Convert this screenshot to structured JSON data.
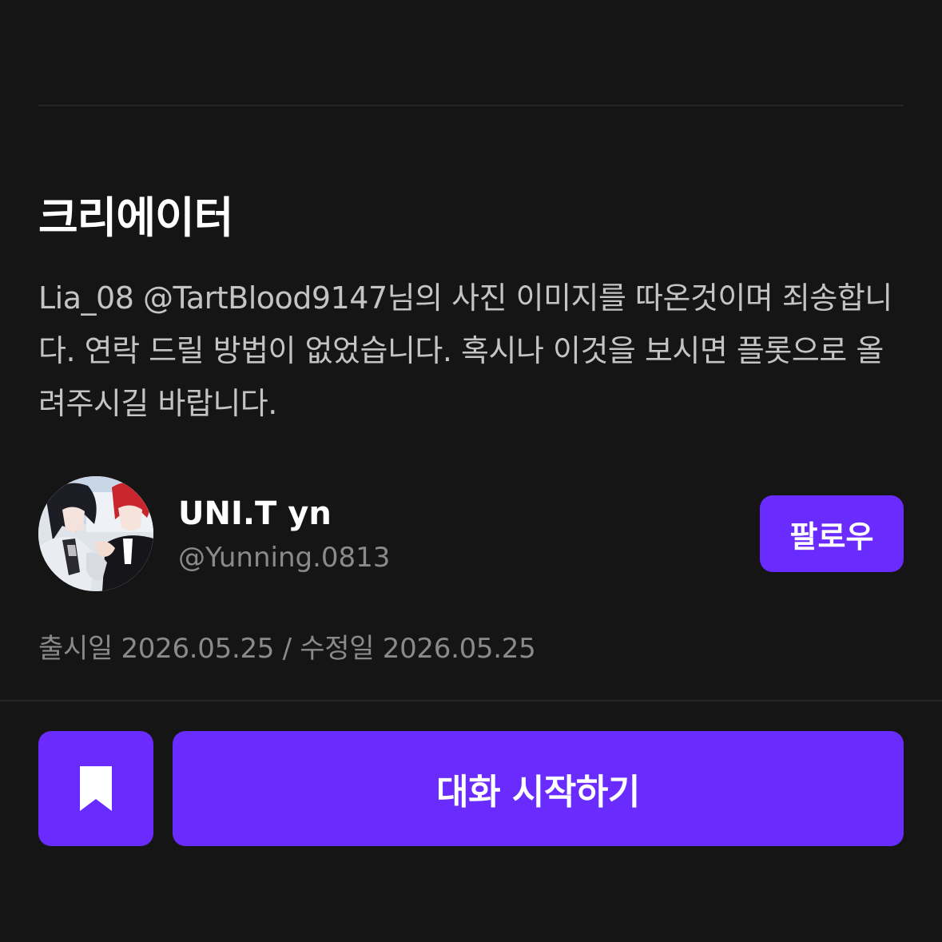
{
  "section": {
    "title": "크리에이터",
    "description": "Lia_08 @TartBlood9147님의 사진 이미지를 따온것이며 죄송합니다. 연락 드릴 방법이 없었습니다. 혹시나 이것을 보시면 플롯으로 올려주시길 바랍니다."
  },
  "creator": {
    "name": "UNI.T yn",
    "handle": "@Yunning.0813",
    "follow_label": "팔로우",
    "avatar_icon": "character-avatar-image"
  },
  "release_info": "출시일 2026.05.25 / 수정일 2026.05.25",
  "actions": {
    "bookmark_icon": "bookmark-icon",
    "start_label": "대화 시작하기"
  },
  "colors": {
    "background": "#151515",
    "accent": "#6a2bff",
    "text_primary": "#ffffff",
    "text_secondary": "#8a8a8a",
    "text_body": "#c4c4c4"
  }
}
